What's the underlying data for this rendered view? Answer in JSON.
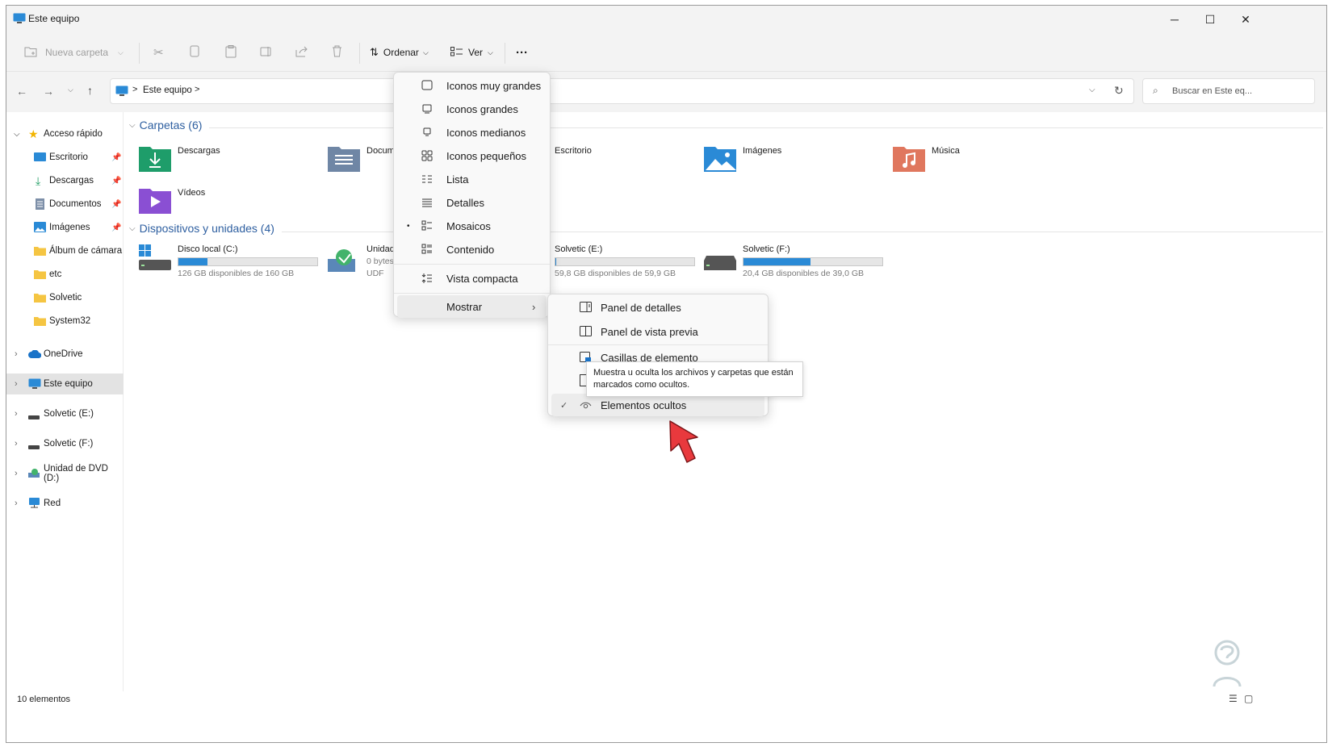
{
  "window": {
    "title": "Este equipo",
    "controls": {
      "minimize": "─",
      "maximize": "☐",
      "close": "✕"
    }
  },
  "toolbar": {
    "new_folder": "Nueva carpeta",
    "sort": "Ordenar",
    "view": "Ver",
    "more": "···"
  },
  "address": {
    "crumb": "Este equipo",
    "separator": ">",
    "search_placeholder": "Buscar en Este eq..."
  },
  "nav": {
    "quick_access": "Acceso rápido",
    "quick_items": [
      {
        "label": "Escritorio",
        "pinned": true
      },
      {
        "label": "Descargas",
        "pinned": true
      },
      {
        "label": "Documentos",
        "pinned": true
      },
      {
        "label": "Imágenes",
        "pinned": true
      },
      {
        "label": "Álbum de cámara",
        "pinned": false
      },
      {
        "label": "etc",
        "pinned": false
      },
      {
        "label": "Solvetic",
        "pinned": false
      },
      {
        "label": "System32",
        "pinned": false
      }
    ],
    "roots": [
      {
        "label": "OneDrive"
      },
      {
        "label": "Este equipo",
        "selected": true
      },
      {
        "label": "Solvetic (E:)"
      },
      {
        "label": "Solvetic (F:)"
      },
      {
        "label": "Unidad de DVD (D:)"
      },
      {
        "label": "Red"
      }
    ]
  },
  "folders": {
    "header": "Carpetas (6)",
    "items": [
      "Descargas",
      "Documentos",
      "Escritorio",
      "Imágenes",
      "Música",
      "Vídeos"
    ]
  },
  "devices": {
    "header": "Dispositivos y unidades (4)",
    "items": [
      {
        "name": "Disco local (C:)",
        "free": "126 GB disponibles de 160 GB",
        "used_fraction": 0.21
      },
      {
        "name": "Unidad de DVD (D:)",
        "line2": "0 bytes disponibles de",
        "line3": "UDF"
      },
      {
        "name": "Solvetic (E:)",
        "free": "59,8 GB disponibles de 59,9 GB",
        "used_fraction": 0.002
      },
      {
        "name": "Solvetic (F:)",
        "free": "20,4 GB disponibles de 39,0 GB",
        "used_fraction": 0.48
      }
    ]
  },
  "view_menu": {
    "items": [
      "Iconos muy grandes",
      "Iconos grandes",
      "Iconos medianos",
      "Iconos pequeños",
      "Lista",
      "Detalles",
      "Mosaicos",
      "Contenido"
    ],
    "selected": "Mosaicos",
    "compact": "Vista compacta",
    "show": "Mostrar"
  },
  "show_submenu": {
    "details_pane": "Panel de detalles",
    "preview_pane": "Panel de vista previa",
    "item_checkboxes": "Casillas de elemento",
    "hidden_items": "Elementos ocultos"
  },
  "tooltip": "Muestra u oculta los archivos y carpetas que están marcados como ocultos.",
  "status": {
    "count": "10 elementos"
  },
  "colors": {
    "accent": "#2a8ad6",
    "section_header": "#2e5fa0",
    "cursor_arrow": "#e8393d"
  }
}
